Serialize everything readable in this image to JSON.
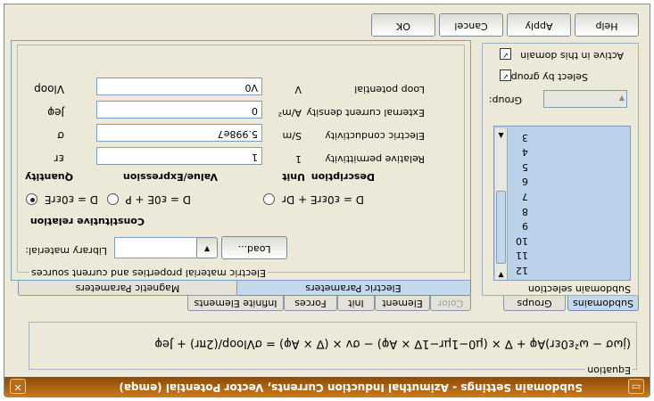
{
  "window": {
    "title": "Subdomain Settings - Azimuthal Induction Currents, Vector Potential (emqa)"
  },
  "buttons": {
    "ok": "OK",
    "cancel": "Cancel",
    "apply": "Apply",
    "help": "Help"
  },
  "left": {
    "active_label": "Active in this domain",
    "active_checked": true,
    "select_by_group_label": "Select by group",
    "select_by_group_checked": true,
    "group_label": "Group:",
    "group_value": "",
    "list_items": [
      "12",
      "11",
      "10",
      "9",
      "8",
      "7",
      "6",
      "5",
      "4",
      "3"
    ],
    "subdomain_selection_label": "Subdomain selection",
    "tabs": [
      "Subdomains",
      "Groups"
    ]
  },
  "tabs_row1": [
    "Infinite Elements",
    "Forces",
    "Init",
    "Element",
    "Color"
  ],
  "tabs_row2": [
    "Magnetic Parameters",
    "Electric Parameters"
  ],
  "electric": {
    "group_label": "Electric material properties and current sources",
    "library_material_label": "Library material:",
    "library_material_value": "",
    "load_button": "Load...",
    "constitutive_label": "Constitutive relation",
    "relations": [
      "D = ε0εrE",
      "D = ε0E + P",
      "D = ε0εrE + Dr"
    ],
    "selected_relation": 0,
    "headers": {
      "quantity": "Quantity",
      "value": "Value/Expression",
      "unit": "Unit",
      "description": "Description"
    },
    "rows": [
      {
        "quantity": "εr",
        "value": "1",
        "unit": "1",
        "description": "Relative permittivity"
      },
      {
        "quantity": "σ",
        "value": "5.998e7",
        "unit": "S/m",
        "description": "Electric conductivity"
      },
      {
        "quantity": "Jeφ",
        "value": "0",
        "unit": "A/m²",
        "description": "External current density"
      },
      {
        "quantity": "Vloop",
        "value": "V0",
        "unit": "V",
        "description": "Loop potential"
      }
    ]
  },
  "equation": {
    "label": "Equation",
    "text": "(jωσ − ω²ε0εr)Aφ + ∇ × (μ0−1μr−1∇ × Aφ) − σv × (∇ × Aφ) = σVloop/(2πr) + Jeφ"
  }
}
